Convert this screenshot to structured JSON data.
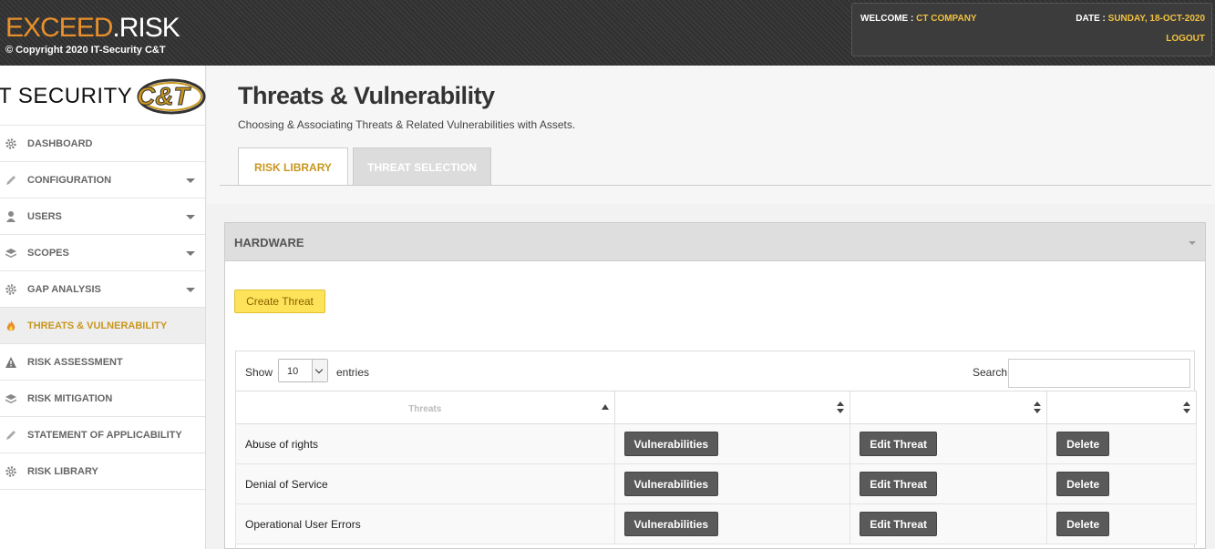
{
  "header": {
    "brand_part1": "EXCEED",
    "brand_part2": ".RISK",
    "copyright": "© Copyright 2020 IT-Security C&T",
    "welcome_label": "WELCOME : ",
    "welcome_value": "CT COMPANY",
    "date_label": "DATE : ",
    "date_value": "SUNDAY, 18-OCT-2020",
    "logout": "LOGOUT"
  },
  "sidebar": {
    "logo_text": "T SECURITY",
    "logo_ct": "C&T",
    "items": [
      {
        "label": "DASHBOARD",
        "icon": "gear-icon",
        "caret": false,
        "active": false
      },
      {
        "label": "CONFIGURATION",
        "icon": "pencil-icon",
        "caret": true,
        "active": false
      },
      {
        "label": "USERS",
        "icon": "user-icon",
        "caret": true,
        "active": false
      },
      {
        "label": "SCOPES",
        "icon": "layers-icon",
        "caret": true,
        "active": false
      },
      {
        "label": "GAP ANALYSIS",
        "icon": "gear-icon",
        "caret": true,
        "active": false
      },
      {
        "label": "THREATS & VULNERABILITY",
        "icon": "fire-icon",
        "caret": false,
        "active": true
      },
      {
        "label": "RISK ASSESSMENT",
        "icon": "warning-icon",
        "caret": false,
        "active": false
      },
      {
        "label": "RISK MITIGATION",
        "icon": "layers-icon",
        "caret": false,
        "active": false
      },
      {
        "label": "STATEMENT OF APPLICABILITY",
        "icon": "pencil-icon",
        "caret": false,
        "active": false
      },
      {
        "label": "RISK LIBRARY",
        "icon": "gear-icon",
        "caret": false,
        "active": false
      }
    ]
  },
  "main": {
    "title": "Threats & Vulnerability",
    "subtitle": "Choosing & Associating Threats & Related Vulnerabilities with Assets.",
    "tabs": [
      {
        "label": "RISK LIBRARY",
        "active": true
      },
      {
        "label": "THREAT SELECTION",
        "active": false
      }
    ],
    "panel_title": "HARDWARE",
    "create_button": "Create Threat",
    "table": {
      "show_label": "Show",
      "page_size": "10",
      "entries_label": "entries",
      "search_label": "Search:",
      "search_value": "",
      "columns": [
        "Threats",
        "",
        "",
        ""
      ],
      "rows": [
        {
          "threat": "Abuse of rights",
          "vuln": "Vulnerabilities",
          "edit": "Edit Threat",
          "delete": "Delete"
        },
        {
          "threat": "Denial of Service",
          "vuln": "Vulnerabilities",
          "edit": "Edit Threat",
          "delete": "Delete"
        },
        {
          "threat": "Operational User Errors",
          "vuln": "Vulnerabilities",
          "edit": "Edit Threat",
          "delete": "Delete"
        }
      ]
    }
  },
  "colors": {
    "accent": "#c8961e",
    "brand_orange": "#e8902b",
    "header_bg": "#333333",
    "create_button": "#fde359",
    "action_button": "#5a5a5a"
  }
}
